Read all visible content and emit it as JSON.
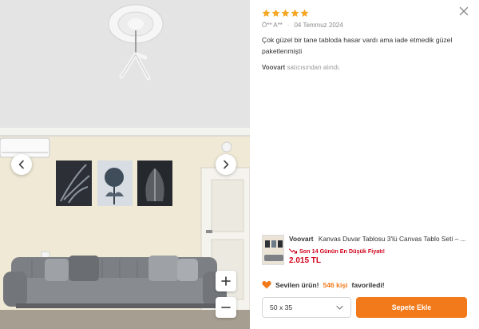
{
  "review": {
    "rating": 5,
    "author": "Ö** A**",
    "date": "04 Temmuz 2024",
    "text": "Çok güzel bir tane tabloda hasar vardı ama iade etmedik güzel paketlenmişti",
    "seller_name": "Voovart",
    "seller_suffix": "satıcısından alındı."
  },
  "product": {
    "brand": "Voovart",
    "title": "Kanvas Duvar Tablosu 3'lü Canvas Tablo Seti – ...",
    "lowest_price_badge": "Son 14 Günün En Düşük Fiyatı!",
    "price": "2.015 TL"
  },
  "favorite": {
    "prefix": "Sevilen ürün!",
    "count": "546 kişi",
    "suffix": "favoriledi!"
  },
  "size_select": {
    "selected": "50 x 35"
  },
  "add_to_cart": {
    "label": "Sepete Ekle"
  },
  "colors": {
    "accent": "#f27a1a",
    "star": "#f5a623",
    "price": "#d0021b"
  },
  "icons": {
    "prev": "chevron-left-icon",
    "next": "chevron-right-icon",
    "zoom_in": "plus-icon",
    "zoom_out": "minus-icon",
    "close": "close-icon",
    "favorite": "heart-icon",
    "lowest": "trend-down-icon"
  }
}
